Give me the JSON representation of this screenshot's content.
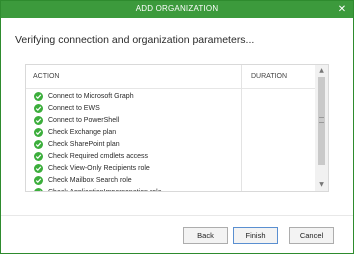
{
  "window": {
    "title": "ADD ORGANIZATION",
    "close_glyph": "✕"
  },
  "heading": "Verifying connection and organization parameters...",
  "table": {
    "columns": [
      "ACTION",
      "DURATION"
    ],
    "status_icon": "check-circle-icon",
    "status_color": "#3cae3c",
    "rows": [
      "Connect to Microsoft Graph",
      "Connect to EWS",
      "Connect to PowerShell",
      "Check Exchange plan",
      "Check SharePoint plan",
      "Check Required cmdlets access",
      "Check View-Only Recipients role",
      "Check Mailbox Search role",
      "Check ApplicationImpersonation role"
    ]
  },
  "buttons": {
    "back": "Back",
    "finish": "Finish",
    "cancel": "Cancel"
  },
  "colors": {
    "titlebar": "#3c9a3c",
    "accent": "#3cae3c"
  }
}
